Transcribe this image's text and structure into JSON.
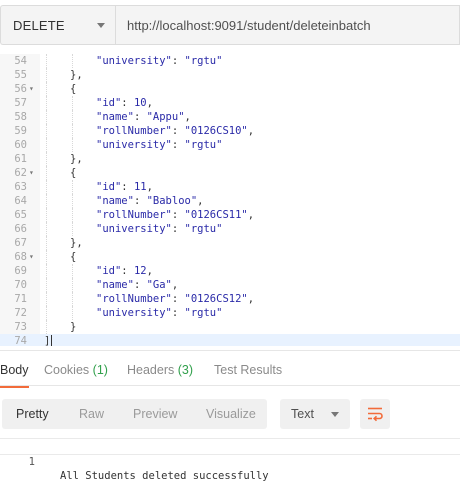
{
  "request": {
    "method": "DELETE",
    "url": "http://localhost:9091/student/deleteinbatch"
  },
  "editor": {
    "lines": [
      {
        "n": "54",
        "fold": false,
        "indent": 2,
        "tokens": [
          [
            "k",
            "\"university\""
          ],
          [
            "p",
            ": "
          ],
          [
            "s",
            "\"rgtu\""
          ]
        ]
      },
      {
        "n": "55",
        "fold": false,
        "indent": 1,
        "tokens": [
          [
            "p",
            "},"
          ]
        ]
      },
      {
        "n": "56",
        "fold": true,
        "indent": 1,
        "tokens": [
          [
            "p",
            "{"
          ]
        ]
      },
      {
        "n": "57",
        "fold": false,
        "indent": 2,
        "tokens": [
          [
            "k",
            "\"id\""
          ],
          [
            "p",
            ": "
          ],
          [
            "n",
            "10"
          ],
          [
            "p",
            ","
          ]
        ]
      },
      {
        "n": "58",
        "fold": false,
        "indent": 2,
        "tokens": [
          [
            "k",
            "\"name\""
          ],
          [
            "p",
            ": "
          ],
          [
            "s",
            "\"Appu\""
          ],
          [
            "p",
            ","
          ]
        ]
      },
      {
        "n": "59",
        "fold": false,
        "indent": 2,
        "tokens": [
          [
            "k",
            "\"rollNumber\""
          ],
          [
            "p",
            ": "
          ],
          [
            "s",
            "\"0126CS10\""
          ],
          [
            "p",
            ","
          ]
        ]
      },
      {
        "n": "60",
        "fold": false,
        "indent": 2,
        "tokens": [
          [
            "k",
            "\"university\""
          ],
          [
            "p",
            ": "
          ],
          [
            "s",
            "\"rgtu\""
          ]
        ]
      },
      {
        "n": "61",
        "fold": false,
        "indent": 1,
        "tokens": [
          [
            "p",
            "},"
          ]
        ]
      },
      {
        "n": "62",
        "fold": true,
        "indent": 1,
        "tokens": [
          [
            "p",
            "{"
          ]
        ]
      },
      {
        "n": "63",
        "fold": false,
        "indent": 2,
        "tokens": [
          [
            "k",
            "\"id\""
          ],
          [
            "p",
            ": "
          ],
          [
            "n",
            "11"
          ],
          [
            "p",
            ","
          ]
        ]
      },
      {
        "n": "64",
        "fold": false,
        "indent": 2,
        "tokens": [
          [
            "k",
            "\"name\""
          ],
          [
            "p",
            ": "
          ],
          [
            "s",
            "\"Babloo\""
          ],
          [
            "p",
            ","
          ]
        ]
      },
      {
        "n": "65",
        "fold": false,
        "indent": 2,
        "tokens": [
          [
            "k",
            "\"rollNumber\""
          ],
          [
            "p",
            ": "
          ],
          [
            "s",
            "\"0126CS11\""
          ],
          [
            "p",
            ","
          ]
        ]
      },
      {
        "n": "66",
        "fold": false,
        "indent": 2,
        "tokens": [
          [
            "k",
            "\"university\""
          ],
          [
            "p",
            ": "
          ],
          [
            "s",
            "\"rgtu\""
          ]
        ]
      },
      {
        "n": "67",
        "fold": false,
        "indent": 1,
        "tokens": [
          [
            "p",
            "},"
          ]
        ]
      },
      {
        "n": "68",
        "fold": true,
        "indent": 1,
        "tokens": [
          [
            "p",
            "{"
          ]
        ]
      },
      {
        "n": "69",
        "fold": false,
        "indent": 2,
        "tokens": [
          [
            "k",
            "\"id\""
          ],
          [
            "p",
            ": "
          ],
          [
            "n",
            "12"
          ],
          [
            "p",
            ","
          ]
        ]
      },
      {
        "n": "70",
        "fold": false,
        "indent": 2,
        "tokens": [
          [
            "k",
            "\"name\""
          ],
          [
            "p",
            ": "
          ],
          [
            "s",
            "\"Ga\""
          ],
          [
            "p",
            ","
          ]
        ]
      },
      {
        "n": "71",
        "fold": false,
        "indent": 2,
        "tokens": [
          [
            "k",
            "\"rollNumber\""
          ],
          [
            "p",
            ": "
          ],
          [
            "s",
            "\"0126CS12\""
          ],
          [
            "p",
            ","
          ]
        ]
      },
      {
        "n": "72",
        "fold": false,
        "indent": 2,
        "tokens": [
          [
            "k",
            "\"university\""
          ],
          [
            "p",
            ": "
          ],
          [
            "s",
            "\"rgtu\""
          ]
        ]
      },
      {
        "n": "73",
        "fold": false,
        "indent": 1,
        "tokens": [
          [
            "p",
            "}"
          ]
        ]
      },
      {
        "n": "74",
        "fold": false,
        "indent": 0,
        "tokens": [
          [
            "p",
            "]"
          ]
        ],
        "active": true
      }
    ]
  },
  "response_tabs": {
    "body": "Body",
    "cookies": "Cookies",
    "cookies_count": "(1)",
    "headers": "Headers",
    "headers_count": "(3)",
    "test_results": "Test Results"
  },
  "view_modes": {
    "pretty": "Pretty",
    "raw": "Raw",
    "preview": "Preview",
    "visualize": "Visualize"
  },
  "format_select": "Text",
  "wrap_icon": "wrap-lines-icon",
  "response": {
    "line_number": "1",
    "text": "All Students deleted successfully"
  },
  "colors": {
    "accent": "#f26b3a",
    "count_green": "#31a04c",
    "json_value": "#2a2aa8"
  }
}
